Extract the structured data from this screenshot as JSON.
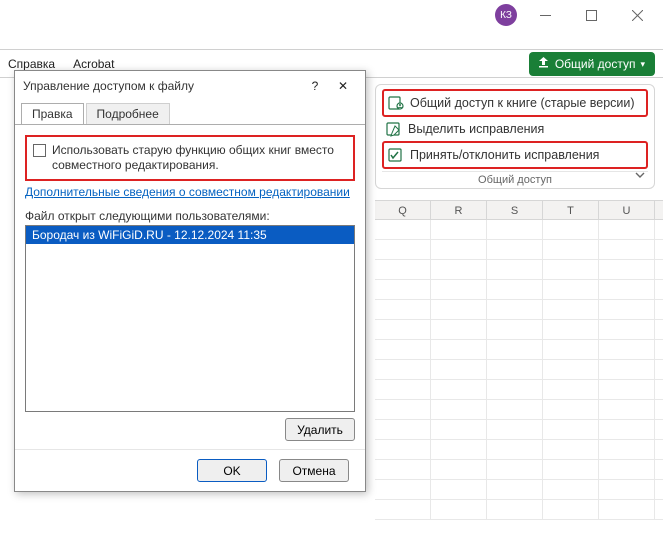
{
  "titlebar": {
    "avatar": "КЗ"
  },
  "ribbon": {
    "tab_help": "Справка",
    "tab_acrobat": "Acrobat",
    "share": "Общий доступ",
    "cmd_share_book": "Общий доступ к книге (старые версии)",
    "cmd_highlight": "Выделить исправления",
    "cmd_accept": "Принять/отклонить исправления",
    "group_label": "Общий доступ"
  },
  "grid": {
    "cols": [
      "Q",
      "R",
      "S",
      "T",
      "U"
    ]
  },
  "dialog": {
    "title": "Управление доступом к файлу",
    "tab_edit": "Правка",
    "tab_more": "Подробнее",
    "checkbox_text_full": "Использовать старую функцию общих книг вместо совместного редактирования.",
    "link": "Дополнительные сведения о совместном редактировании",
    "list_label": "Файл открыт следующими пользователями:",
    "list_item": "Бородач из WiFiGiD.RU - 12.12.2024 11:35",
    "delete": "Удалить",
    "ok": "OK",
    "cancel": "Отмена",
    "help": "?",
    "close": "✕"
  }
}
